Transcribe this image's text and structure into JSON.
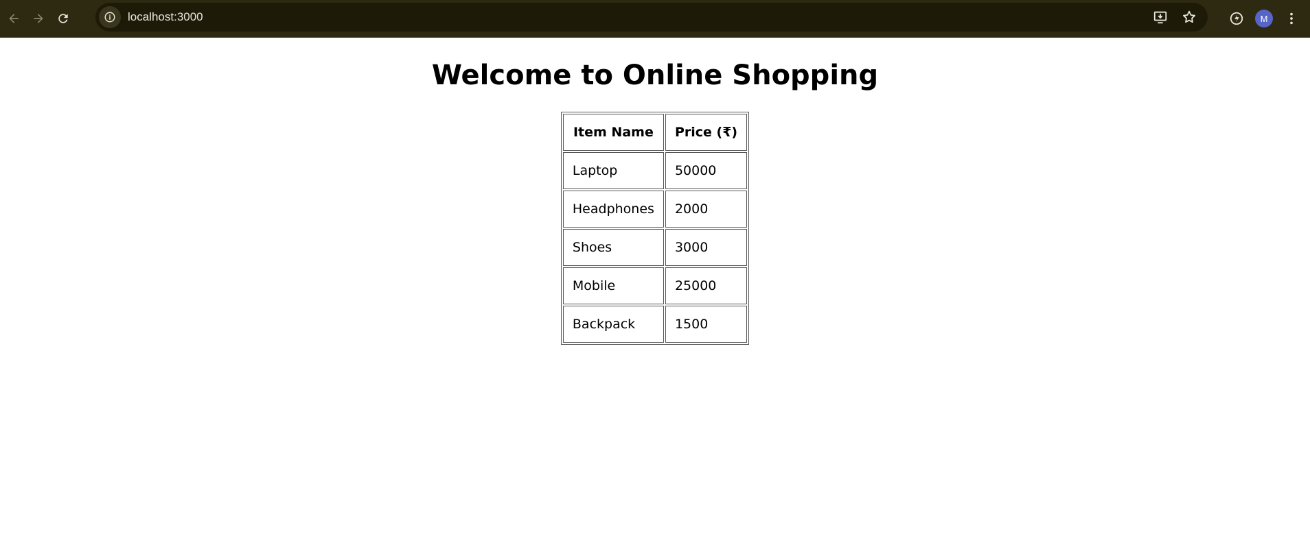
{
  "browser": {
    "url": "localhost:3000",
    "profile_initial": "M",
    "icons": {
      "back": "arrow-left-icon",
      "forward": "arrow-right-icon",
      "reload": "reload-icon",
      "site_info": "info-icon",
      "install": "install-app-icon",
      "bookmark": "star-icon",
      "extension": "extension-icon",
      "menu": "kebab-menu-icon"
    },
    "colors": {
      "toolbar_bg": "#2e2a12",
      "omnibox_bg": "#1d1a08",
      "avatar_bg": "#5865c8"
    }
  },
  "page": {
    "heading": "Welcome to Online Shopping",
    "table": {
      "headers": [
        "Item Name",
        "Price (₹)"
      ],
      "rows": [
        [
          "Laptop",
          "50000"
        ],
        [
          "Headphones",
          "2000"
        ],
        [
          "Shoes",
          "3000"
        ],
        [
          "Mobile",
          "25000"
        ],
        [
          "Backpack",
          "1500"
        ]
      ]
    }
  }
}
